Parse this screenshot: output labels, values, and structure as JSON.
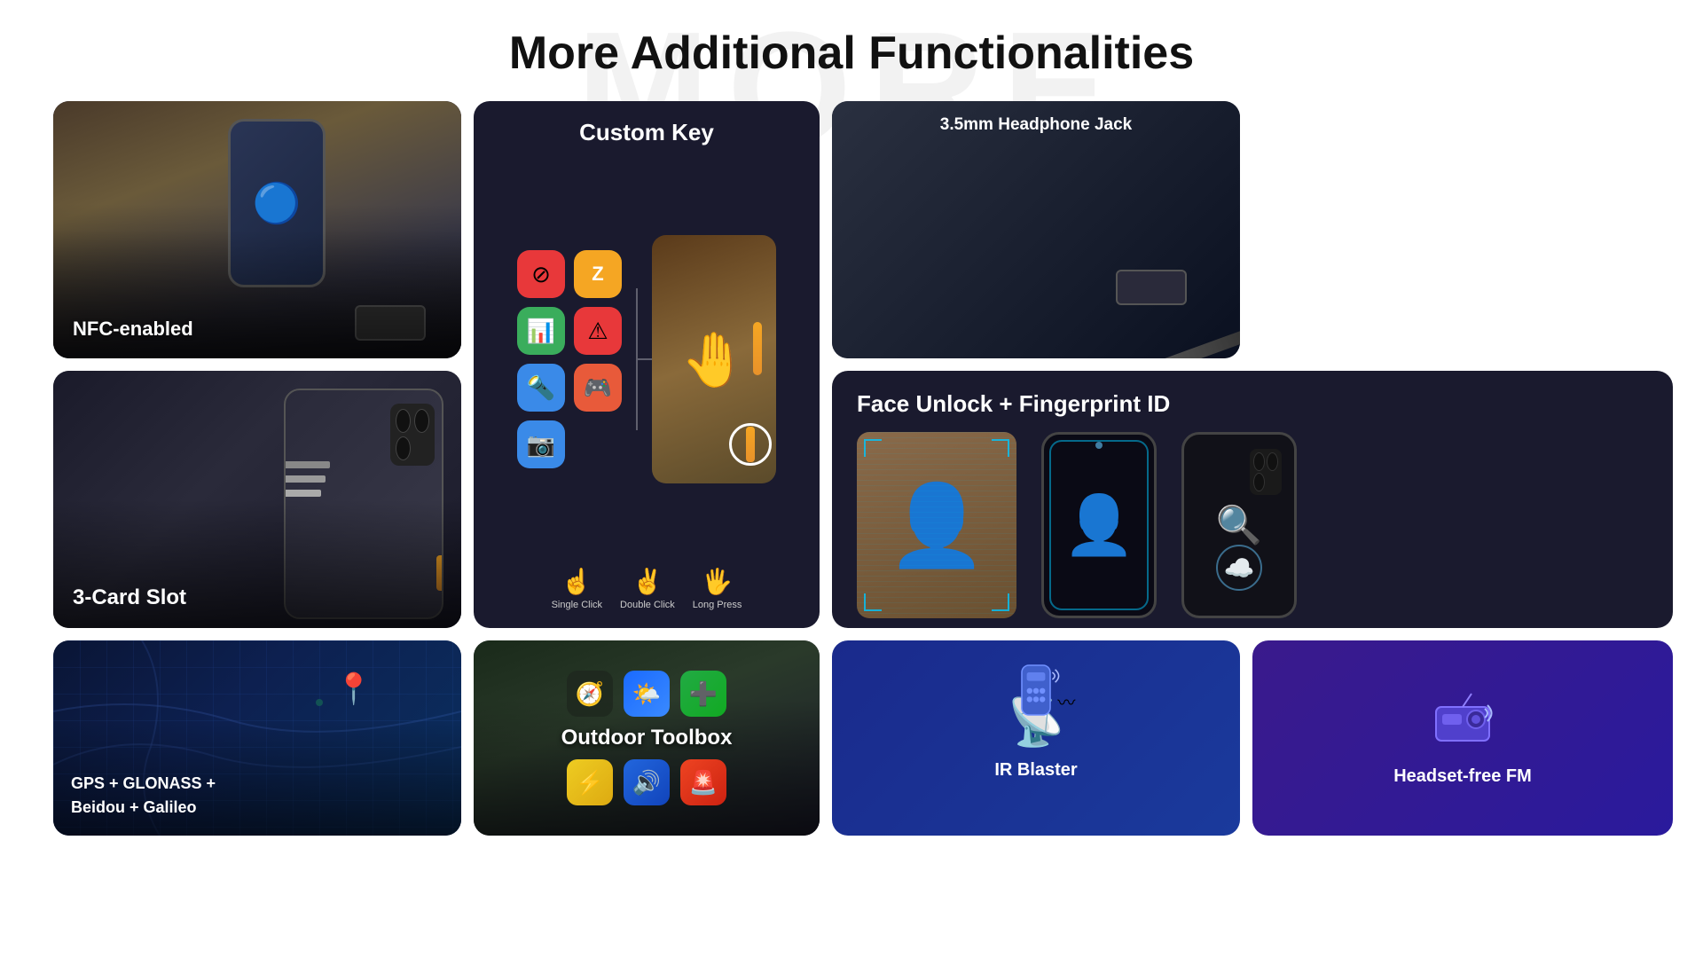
{
  "page": {
    "watermark": "MORE",
    "title": "More Additional Functionalities"
  },
  "cards": {
    "nfc": {
      "label": "NFC-enabled"
    },
    "custom_key": {
      "title": "Custom Key",
      "clicks": [
        {
          "label": "Single Click",
          "icon": "👆"
        },
        {
          "label": "Double Click",
          "icon": "✌️"
        },
        {
          "label": "Long Press",
          "icon": "🖐️"
        }
      ],
      "icons": [
        {
          "symbol": "⊘",
          "color": "icon-red"
        },
        {
          "symbol": "Z",
          "color": "icon-orange"
        },
        {
          "symbol": "📊",
          "color": "icon-green"
        },
        {
          "symbol": "⚠",
          "color": "icon-red2"
        },
        {
          "symbol": "🔦",
          "color": "icon-blue"
        },
        {
          "symbol": "🎮",
          "color": "icon-red3"
        },
        {
          "symbol": "📷",
          "color": "icon-blue2"
        }
      ]
    },
    "headphone": {
      "label": "3.5mm Headphone Jack"
    },
    "face_unlock": {
      "label": "Face Unlock + Fingerprint ID"
    },
    "three_card": {
      "label": "3-Card Slot"
    },
    "gps": {
      "label": "GPS + GLONASS +\nBeidou + Galileo"
    },
    "outdoor": {
      "label": "Outdoor Toolbox"
    },
    "ir": {
      "label": "IR Blaster"
    },
    "fm": {
      "label": "Headset-free FM"
    }
  }
}
